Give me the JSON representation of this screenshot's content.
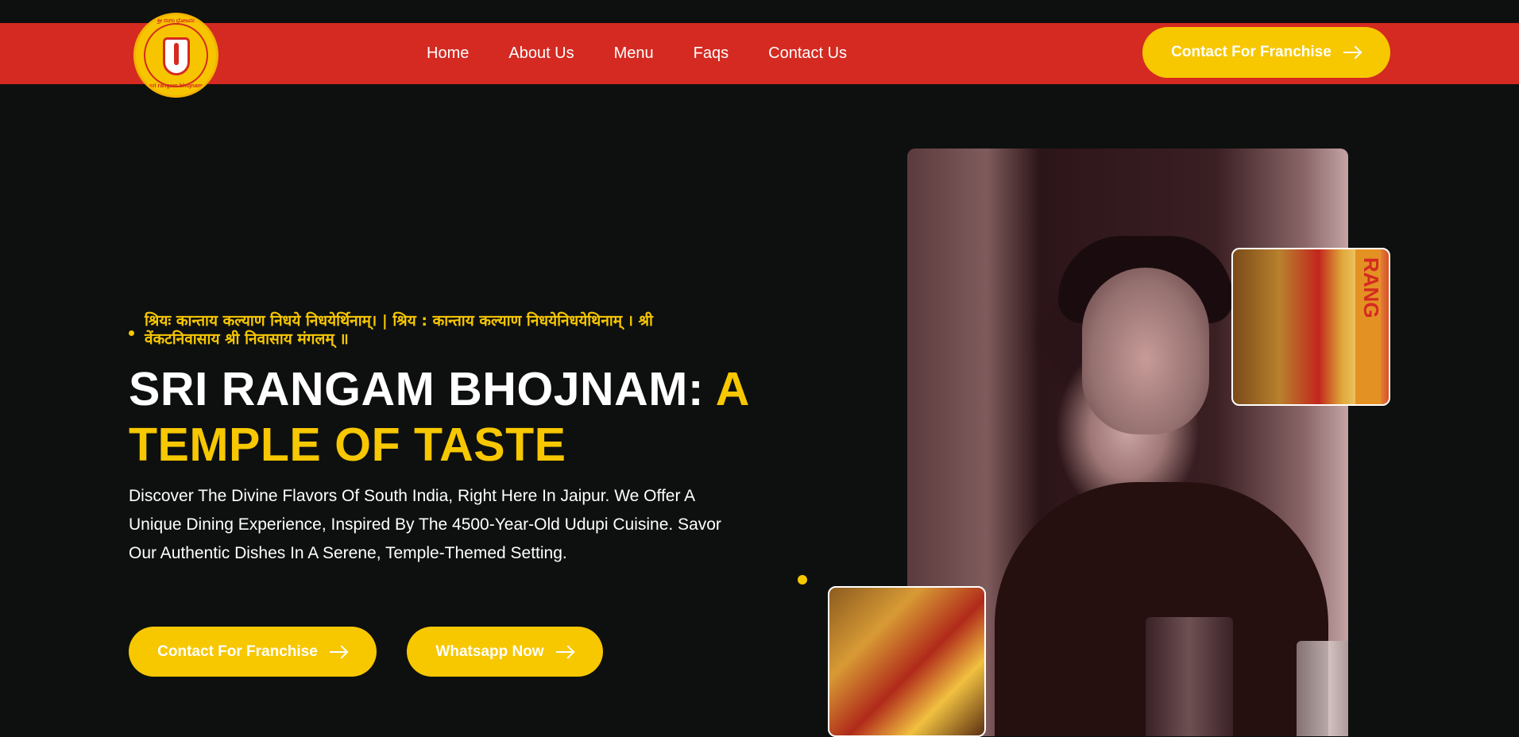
{
  "nav": {
    "logo_alt": "Sri Rangam Bhojnam",
    "logo_text_top": "ಶ್ರೀ ರಂಗಂ ಭೋಜನಂ",
    "logo_text_bottom": "sri rangam bhojnam",
    "links": [
      {
        "label": "Home"
      },
      {
        "label": "About Us"
      },
      {
        "label": "Menu"
      },
      {
        "label": "Faqs"
      },
      {
        "label": "Contact Us"
      }
    ],
    "cta_label": "Contact For Franchise"
  },
  "hero": {
    "mantra": "श्रियः कान्ताय कल्याण निधये निधयेर्थिनाम्। | श्रिय : कान्ताय कल्याण निधयेनिधयेथिनाम् । श्री वेंकटनिवासाय श्री निवासाय मंगलम् ॥",
    "headline_white": "SRI RANGAM BHOJNAM: ",
    "headline_accent": "A TEMPLE OF TASTE",
    "description": "Discover The Divine Flavors Of South India, Right Here In Jaipur. We Offer A Unique Dining Experience, Inspired By The 4500-Year-Old Udupi Cuisine. Savor Our Authentic Dishes In A Serene, Temple-Themed Setting.",
    "buttons": [
      {
        "label": "Contact For Franchise"
      },
      {
        "label": "Whatsapp Now"
      }
    ],
    "thumb_sign_text": "RANG"
  },
  "colors": {
    "nav_red": "#d42a21",
    "accent_yellow": "#f7c700",
    "background": "#0e100f"
  }
}
